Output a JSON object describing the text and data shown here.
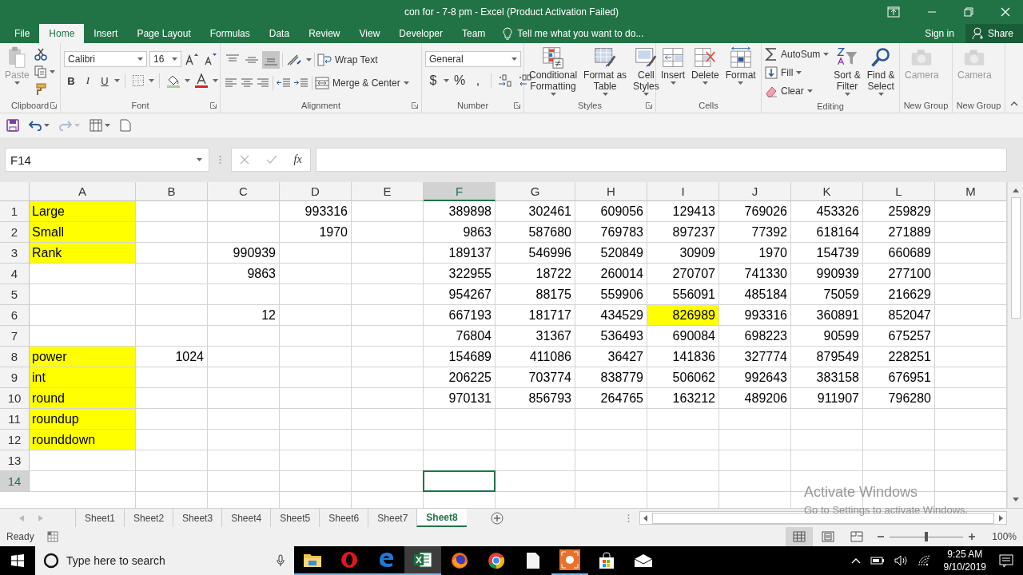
{
  "window": {
    "title": "con for - 7-8 pm - Excel (Product Activation Failed)"
  },
  "menu_tabs": [
    {
      "label": "File",
      "selected": false
    },
    {
      "label": "Home",
      "selected": true
    },
    {
      "label": "Insert",
      "selected": false
    },
    {
      "label": "Page Layout",
      "selected": false
    },
    {
      "label": "Formulas",
      "selected": false
    },
    {
      "label": "Data",
      "selected": false
    },
    {
      "label": "Review",
      "selected": false
    },
    {
      "label": "View",
      "selected": false
    },
    {
      "label": "Developer",
      "selected": false
    },
    {
      "label": "Team",
      "selected": false
    }
  ],
  "tell_me": {
    "placeholder": "Tell me what you want to do..."
  },
  "account": {
    "sign_in": "Sign in",
    "share": "Share"
  },
  "ribbon": {
    "clipboard": {
      "label": "Clipboard",
      "paste": {
        "label": "Paste",
        "disabled": true
      }
    },
    "font": {
      "label": "Font",
      "font_name": "Calibri",
      "font_size": "16",
      "styles": [
        "B",
        "I",
        "U"
      ]
    },
    "alignment": {
      "label": "Alignment",
      "vertical": [
        {
          "selected": false
        },
        {
          "selected": false
        },
        {
          "selected": true
        }
      ],
      "wrap_text": "Wrap Text",
      "merge": "Merge & Center"
    },
    "number": {
      "label": "Number",
      "format": "General",
      "symbols": [
        "$",
        "%",
        ","
      ]
    },
    "styles": {
      "label": "Styles",
      "buttons": [
        [
          "Conditional",
          "Formatting"
        ],
        [
          "Format as",
          "Table"
        ],
        [
          "Cell",
          "Styles"
        ]
      ]
    },
    "cells": {
      "label": "Cells",
      "buttons": [
        "Insert",
        "Delete",
        "Format"
      ]
    },
    "editing": {
      "label": "Editing",
      "small": [
        "AutoSum",
        "Fill",
        "Clear"
      ],
      "large": [
        [
          "Sort &",
          "Filter"
        ],
        [
          "Find &",
          "Select"
        ]
      ]
    },
    "custom_groups": [
      {
        "label": "New Group",
        "button": "Camera",
        "disabled": true
      },
      {
        "label": "New Group",
        "button": "Camera",
        "disabled": true
      }
    ]
  },
  "quick_access": [
    {
      "disabled": false
    },
    {
      "disabled": false
    },
    {
      "disabled": true
    },
    {
      "disabled": false
    },
    {
      "disabled": false
    }
  ],
  "formula_bar": {
    "name_box": "F14",
    "function_label": "fx",
    "buttons_disabled": true
  },
  "columns": [
    {
      "label": "A",
      "selected": false
    },
    {
      "label": "B",
      "selected": false
    },
    {
      "label": "C",
      "selected": false
    },
    {
      "label": "D",
      "selected": false
    },
    {
      "label": "E",
      "selected": false
    },
    {
      "label": "F",
      "selected": true
    },
    {
      "label": "G",
      "selected": false
    },
    {
      "label": "H",
      "selected": false
    },
    {
      "label": "I",
      "selected": false
    },
    {
      "label": "J",
      "selected": false
    },
    {
      "label": "K",
      "selected": false
    },
    {
      "label": "L",
      "selected": false
    },
    {
      "label": "M",
      "selected": false
    }
  ],
  "rows": [
    {
      "number": "1",
      "cells": [
        {
          "value": "Large",
          "kind": "text",
          "color": "#ffff00",
          "selected": false
        },
        null,
        null,
        {
          "value": "993316",
          "kind": "number",
          "selected": false
        },
        null,
        {
          "value": "389898",
          "kind": "number",
          "selected": false
        },
        {
          "value": "302461",
          "kind": "number",
          "selected": false
        },
        {
          "value": "609056",
          "kind": "number",
          "selected": false
        },
        {
          "value": "129413",
          "kind": "number",
          "selected": false
        },
        {
          "value": "769026",
          "kind": "number",
          "selected": false
        },
        {
          "value": "453326",
          "kind": "number",
          "selected": false
        },
        {
          "value": "259829",
          "kind": "number",
          "selected": false
        },
        null
      ]
    },
    {
      "number": "2",
      "cells": [
        {
          "value": "Small",
          "kind": "text",
          "color": "#ffff00",
          "selected": false
        },
        null,
        null,
        {
          "value": "1970",
          "kind": "number",
          "selected": false
        },
        null,
        {
          "value": "9863",
          "kind": "number",
          "selected": false
        },
        {
          "value": "587680",
          "kind": "number",
          "selected": false
        },
        {
          "value": "769783",
          "kind": "number",
          "selected": false
        },
        {
          "value": "897237",
          "kind": "number",
          "selected": false
        },
        {
          "value": "77392",
          "kind": "number",
          "selected": false
        },
        {
          "value": "618164",
          "kind": "number",
          "selected": false
        },
        {
          "value": "271889",
          "kind": "number",
          "selected": false
        },
        null
      ]
    },
    {
      "number": "3",
      "cells": [
        {
          "value": "Rank",
          "kind": "text",
          "color": "#ffff00",
          "selected": false
        },
        null,
        {
          "value": "990939",
          "kind": "number",
          "selected": false
        },
        null,
        null,
        {
          "value": "189137",
          "kind": "number",
          "selected": false
        },
        {
          "value": "546996",
          "kind": "number",
          "selected": false
        },
        {
          "value": "520849",
          "kind": "number",
          "selected": false
        },
        {
          "value": "30909",
          "kind": "number",
          "selected": false
        },
        {
          "value": "1970",
          "kind": "number",
          "selected": false
        },
        {
          "value": "154739",
          "kind": "number",
          "selected": false
        },
        {
          "value": "660689",
          "kind": "number",
          "selected": false
        },
        null
      ]
    },
    {
      "number": "4",
      "cells": [
        null,
        null,
        {
          "value": "9863",
          "kind": "number",
          "selected": false
        },
        null,
        null,
        {
          "value": "322955",
          "kind": "number",
          "selected": false
        },
        {
          "value": "18722",
          "kind": "number",
          "selected": false
        },
        {
          "value": "260014",
          "kind": "number",
          "selected": false
        },
        {
          "value": "270707",
          "kind": "number",
          "selected": false
        },
        {
          "value": "741330",
          "kind": "number",
          "selected": false
        },
        {
          "value": "990939",
          "kind": "number",
          "selected": false
        },
        {
          "value": "277100",
          "kind": "number",
          "selected": false
        },
        null
      ]
    },
    {
      "number": "5",
      "cells": [
        null,
        null,
        null,
        null,
        null,
        {
          "value": "954267",
          "kind": "number",
          "selected": false
        },
        {
          "value": "88175",
          "kind": "number",
          "selected": false
        },
        {
          "value": "559906",
          "kind": "number",
          "selected": false
        },
        {
          "value": "556091",
          "kind": "number",
          "selected": false
        },
        {
          "value": "485184",
          "kind": "number",
          "selected": false
        },
        {
          "value": "75059",
          "kind": "number",
          "selected": false
        },
        {
          "value": "216629",
          "kind": "number",
          "selected": false
        },
        null
      ]
    },
    {
      "number": "6",
      "cells": [
        null,
        null,
        {
          "value": "12",
          "kind": "number",
          "selected": false
        },
        null,
        null,
        {
          "value": "667193",
          "kind": "number",
          "selected": false
        },
        {
          "value": "181717",
          "kind": "number",
          "selected": false
        },
        {
          "value": "434529",
          "kind": "number",
          "selected": false
        },
        {
          "value": "826989",
          "kind": "number",
          "color": "#ffff00",
          "selected": false
        },
        {
          "value": "993316",
          "kind": "number",
          "selected": false
        },
        {
          "value": "360891",
          "kind": "number",
          "selected": false
        },
        {
          "value": "852047",
          "kind": "number",
          "selected": false
        },
        null
      ]
    },
    {
      "number": "7",
      "cells": [
        null,
        null,
        null,
        null,
        null,
        {
          "value": "76804",
          "kind": "number",
          "selected": false
        },
        {
          "value": "31367",
          "kind": "number",
          "selected": false
        },
        {
          "value": "536493",
          "kind": "number",
          "selected": false
        },
        {
          "value": "690084",
          "kind": "number",
          "selected": false
        },
        {
          "value": "698223",
          "kind": "number",
          "selected": false
        },
        {
          "value": "90599",
          "kind": "number",
          "selected": false
        },
        {
          "value": "675257",
          "kind": "number",
          "selected": false
        },
        null
      ]
    },
    {
      "number": "8",
      "cells": [
        {
          "value": "power",
          "kind": "text",
          "color": "#ffff00",
          "selected": false
        },
        {
          "value": "1024",
          "kind": "number",
          "selected": false
        },
        null,
        null,
        null,
        {
          "value": "154689",
          "kind": "number",
          "selected": false
        },
        {
          "value": "411086",
          "kind": "number",
          "selected": false
        },
        {
          "value": "36427",
          "kind": "number",
          "selected": false
        },
        {
          "value": "141836",
          "kind": "number",
          "selected": false
        },
        {
          "value": "327774",
          "kind": "number",
          "selected": false
        },
        {
          "value": "879549",
          "kind": "number",
          "selected": false
        },
        {
          "value": "228251",
          "kind": "number",
          "selected": false
        },
        null
      ]
    },
    {
      "number": "9",
      "cells": [
        {
          "value": "int",
          "kind": "text",
          "color": "#ffff00",
          "selected": false
        },
        null,
        null,
        null,
        null,
        {
          "value": "206225",
          "kind": "number",
          "selected": false
        },
        {
          "value": "703774",
          "kind": "number",
          "selected": false
        },
        {
          "value": "838779",
          "kind": "number",
          "selected": false
        },
        {
          "value": "506062",
          "kind": "number",
          "selected": false
        },
        {
          "value": "992643",
          "kind": "number",
          "selected": false
        },
        {
          "value": "383158",
          "kind": "number",
          "selected": false
        },
        {
          "value": "676951",
          "kind": "number",
          "selected": false
        },
        null
      ]
    },
    {
      "number": "10",
      "cells": [
        {
          "value": "round",
          "kind": "text",
          "color": "#ffff00",
          "selected": false
        },
        null,
        null,
        null,
        null,
        {
          "value": "970131",
          "kind": "number",
          "selected": false
        },
        {
          "value": "856793",
          "kind": "number",
          "selected": false
        },
        {
          "value": "264765",
          "kind": "number",
          "selected": false
        },
        {
          "value": "163212",
          "kind": "number",
          "selected": false
        },
        {
          "value": "489206",
          "kind": "number",
          "selected": false
        },
        {
          "value": "911907",
          "kind": "number",
          "selected": false
        },
        {
          "value": "796280",
          "kind": "number",
          "selected": false
        },
        null
      ]
    },
    {
      "number": "11",
      "cells": [
        {
          "value": "roundup",
          "kind": "text",
          "color": "#ffff00",
          "selected": false
        },
        null,
        null,
        null,
        null,
        null,
        null,
        null,
        null,
        null,
        null,
        null,
        null
      ]
    },
    {
      "number": "12",
      "cells": [
        {
          "value": "rounddown",
          "kind": "text",
          "color": "#ffff00",
          "selected": false
        },
        null,
        null,
        null,
        null,
        null,
        null,
        null,
        null,
        null,
        null,
        null,
        null
      ]
    },
    {
      "number": "13",
      "cells": [
        null,
        null,
        null,
        null,
        null,
        null,
        null,
        null,
        null,
        null,
        null,
        null,
        null
      ]
    },
    {
      "number": "14",
      "cells": [
        null,
        null,
        null,
        null,
        null,
        {
          "selected": true
        },
        null,
        null,
        null,
        null,
        null,
        null,
        null
      ]
    }
  ],
  "sheet_tabs": [
    {
      "label": "Sheet1",
      "selected": false
    },
    {
      "label": "Sheet2",
      "selected": false
    },
    {
      "label": "Sheet3",
      "selected": false
    },
    {
      "label": "Sheet4",
      "selected": false
    },
    {
      "label": "Sheet5",
      "selected": false
    },
    {
      "label": "Sheet6",
      "selected": false
    },
    {
      "label": "Sheet7",
      "selected": false
    },
    {
      "label": "Sheet8",
      "selected": true
    }
  ],
  "activation_notice": {
    "title": "Activate Windows",
    "text": "Go to Settings to activate Windows."
  },
  "status_bar": {
    "status": "Ready",
    "views": [
      {
        "selected": true
      },
      {
        "selected": false
      },
      {
        "selected": false
      }
    ],
    "zoom": {
      "label": "100%",
      "level": 0.5
    }
  },
  "taskbar": {
    "search": {
      "placeholder": "Type here to search"
    },
    "apps": [
      {
        "running": true,
        "active": false
      },
      {
        "running": true,
        "active": false
      },
      {
        "running": true,
        "active": false
      },
      {
        "running": true,
        "active": true
      },
      {
        "running": false,
        "active": false
      },
      {
        "running": false,
        "active": false
      },
      {
        "running": false,
        "active": false
      },
      {
        "running": true,
        "active": false
      },
      {
        "running": false,
        "active": false
      },
      {
        "running": false,
        "active": false
      }
    ],
    "time": "9:25 AM",
    "date": "9/10/2019"
  }
}
